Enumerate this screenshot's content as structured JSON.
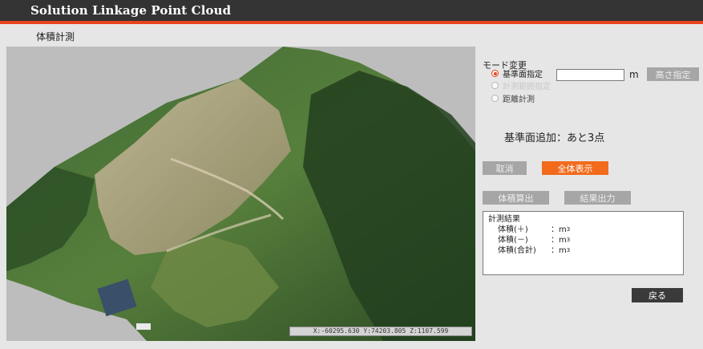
{
  "app": {
    "title": "Solution Linkage Point Cloud"
  },
  "page": {
    "title": "体積計測"
  },
  "viewport": {
    "coords": "X:-60295.630 Y:74203.805 Z:1107.599"
  },
  "mode": {
    "label": "モード変更",
    "options": [
      {
        "label": "基準面指定",
        "selected": true,
        "enabled": true
      },
      {
        "label": "計測範囲指定",
        "selected": false,
        "enabled": false
      },
      {
        "label": "距離計測",
        "selected": false,
        "enabled": true
      }
    ]
  },
  "height": {
    "value": "",
    "unit": "m",
    "button_label": "高さ指定"
  },
  "status": {
    "text": "基準面追加：あと3点"
  },
  "buttons": {
    "cancel": "取消",
    "fit_all": "全体表示",
    "calc_volume": "体積算出",
    "export_results": "結果出力",
    "back": "戻る"
  },
  "results": {
    "header": "計測結果",
    "rows": [
      {
        "label": "体積(＋)",
        "sep": "：",
        "unit": "m",
        "exp": "3"
      },
      {
        "label": "体積(－)",
        "sep": "：",
        "unit": "m",
        "exp": "3"
      },
      {
        "label": "体積(合計)",
        "sep": "：",
        "unit": "m",
        "exp": "3"
      }
    ]
  },
  "colors": {
    "accent": "#e8421e",
    "primary_button": "#f26a1b",
    "titlebar": "#333333",
    "disabled_button": "#a6a6a6"
  }
}
